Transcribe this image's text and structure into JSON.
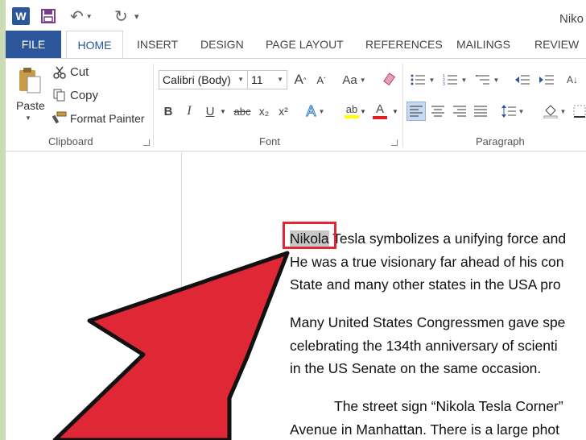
{
  "titlebar": {
    "app_logo": "W",
    "doc_title": "Niko"
  },
  "tabs": [
    "FILE",
    "HOME",
    "INSERT",
    "DESIGN",
    "PAGE LAYOUT",
    "REFERENCES",
    "MAILINGS",
    "REVIEW"
  ],
  "clipboard": {
    "paste_label": "Paste",
    "cut_label": "Cut",
    "copy_label": "Copy",
    "format_painter_label": "Format Painter",
    "group_label": "Clipboard"
  },
  "font": {
    "font_name": "Calibri (Body)",
    "font_size": "11",
    "group_label": "Font",
    "grow_glyph": "A",
    "shrink_glyph": "A",
    "case_glyph": "Aa",
    "bold_glyph": "B",
    "italic_glyph": "I",
    "underline_glyph": "U",
    "strike_glyph": "abc",
    "subscript_glyph": "x₂",
    "superscript_glyph": "x²",
    "effects_glyph": "A",
    "highlight_glyph": "ab",
    "color_glyph": "A",
    "highlight_color": "#ffff00",
    "font_color": "#e02020"
  },
  "paragraph": {
    "group_label": "Paragraph"
  },
  "document": {
    "selected_word": "Nikola",
    "lines": [
      " Tesla symbolizes a unifying force and",
      "He was a true visionary far ahead of his con",
      "State and many other states in the USA pro",
      "Many United States Congressmen gave spe",
      "celebrating the 134th anniversary of scienti",
      "in the US Senate on the same occasion.",
      "The street sign “Nikola Tesla Corner”",
      "Avenue in Manhattan. There is a large phot"
    ]
  },
  "colors": {
    "brand_blue": "#2b579a",
    "arrow_red": "#e02736",
    "page_frame": "#c9dcb4"
  }
}
